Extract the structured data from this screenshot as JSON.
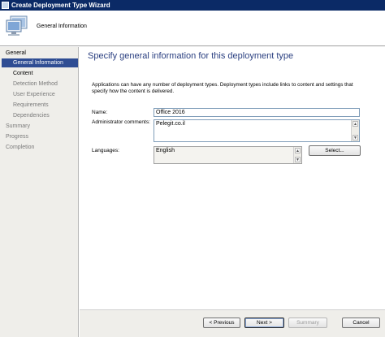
{
  "window": {
    "title": "Create Deployment Type Wizard"
  },
  "header": {
    "subtitle": "General Information"
  },
  "nav": {
    "items": [
      {
        "label": "General",
        "level": "top",
        "state": "dark"
      },
      {
        "label": "General Information",
        "level": "sub",
        "state": "active"
      },
      {
        "label": "Content",
        "level": "sub",
        "state": "dark"
      },
      {
        "label": "Detection Method",
        "level": "sub",
        "state": "dim"
      },
      {
        "label": "User Experience",
        "level": "sub",
        "state": "dim"
      },
      {
        "label": "Requirements",
        "level": "sub",
        "state": "dim"
      },
      {
        "label": "Dependencies",
        "level": "sub",
        "state": "dim"
      },
      {
        "label": "Summary",
        "level": "top",
        "state": "dim"
      },
      {
        "label": "Progress",
        "level": "top",
        "state": "dim"
      },
      {
        "label": "Completion",
        "level": "top",
        "state": "dim"
      }
    ]
  },
  "main": {
    "heading": "Specify general information for this deployment type",
    "description": "Applications can have any number of deployment types. Deployment types include links to content and settings that specify how the content is delivered.",
    "name_label": "Name:",
    "name_value": "Office 2016",
    "comments_label": "Administrator comments:",
    "comments_value": "Pelegit.co.il",
    "languages_label": "Languages:",
    "languages_value": "English",
    "select_button": "Select..."
  },
  "footer": {
    "previous": "< Previous",
    "next": "Next >",
    "summary": "Summary",
    "cancel": "Cancel"
  },
  "colors": {
    "titlebar": "#0b2a66",
    "nav_active": "#2f4d93",
    "heading": "#2a3f80"
  },
  "icons": {
    "window": "app-icon",
    "header": "computer-icon"
  }
}
